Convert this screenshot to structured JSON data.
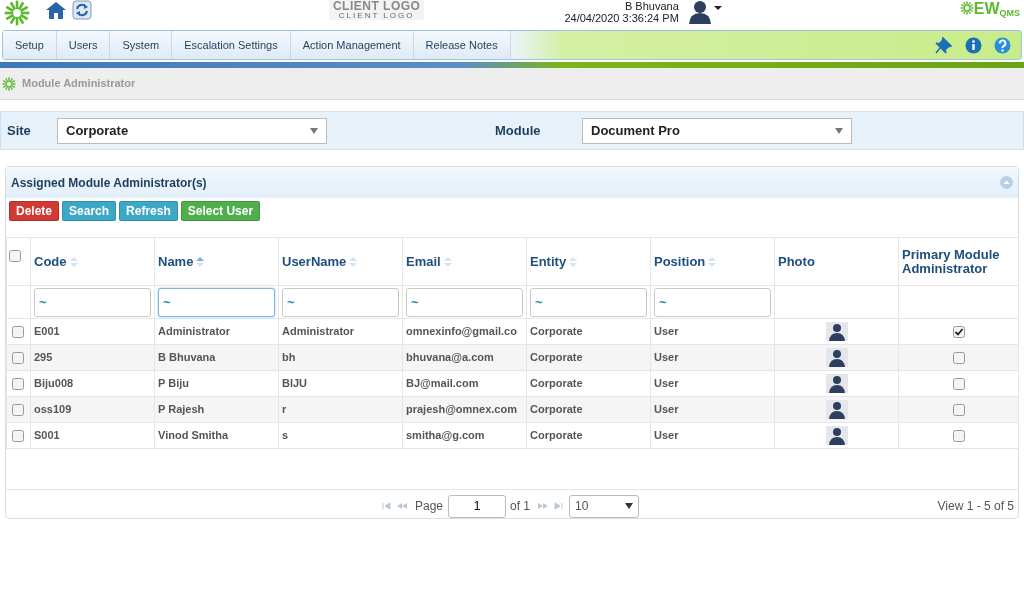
{
  "header": {
    "client_logo": "CLIENT LOGO",
    "client_logo_sub": "CLIENT LOGO",
    "user_name": "B Bhuvana",
    "datetime": "24/04/2020 3:36:24 PM",
    "brand": "EW",
    "brand_sub": "QMS"
  },
  "nav": {
    "items": [
      {
        "label": "Setup"
      },
      {
        "label": "Users"
      },
      {
        "label": "System"
      },
      {
        "label": "Escalation Settings"
      },
      {
        "label": "Action Management"
      },
      {
        "label": "Release Notes"
      }
    ]
  },
  "breadcrumb": {
    "items": [
      {
        "label": "Module Administrator"
      }
    ]
  },
  "selectors": [
    {
      "label": "Site",
      "value": "Corporate"
    },
    {
      "label": "Module",
      "value": "Document Pro"
    }
  ],
  "panel": {
    "title": "Assigned Module Administrator(s)",
    "buttons": [
      {
        "label": "Delete",
        "kind": "danger"
      },
      {
        "label": "Search",
        "kind": "info"
      },
      {
        "label": "Refresh",
        "kind": "info"
      },
      {
        "label": "Select User",
        "kind": "success"
      }
    ],
    "select_all": {
      "checked": false
    },
    "columns": [
      {
        "label": "Code",
        "sorted": false
      },
      {
        "label": "Name",
        "sorted": true
      },
      {
        "label": "UserName",
        "sorted": false
      },
      {
        "label": "Email",
        "sorted": false
      },
      {
        "label": "Entity",
        "sorted": false
      },
      {
        "label": "Position",
        "sorted": false
      },
      {
        "label": "Photo"
      },
      {
        "label": "Primary Module Administrator"
      }
    ],
    "filters": [
      {
        "value": "~",
        "focused": false
      },
      {
        "value": "~",
        "focused": true
      },
      {
        "value": "~",
        "focused": false
      },
      {
        "value": "~",
        "focused": false
      },
      {
        "value": "~",
        "focused": false
      },
      {
        "value": "~",
        "focused": false
      }
    ],
    "rows": [
      {
        "checked": false,
        "code": "E001",
        "name": "Administrator",
        "username": "Administrator",
        "email": "omnexinfo@gmail.co",
        "entity": "Corporate",
        "position": "User",
        "primary": true
      },
      {
        "checked": false,
        "code": "295",
        "name": "B Bhuvana",
        "username": "bh",
        "email": "bhuvana@a.com",
        "entity": "Corporate",
        "position": "User",
        "primary": false
      },
      {
        "checked": false,
        "code": "Biju008",
        "name": "P Biju",
        "username": "BIJU",
        "email": "BJ@mail.com",
        "entity": "Corporate",
        "position": "User",
        "primary": false
      },
      {
        "checked": false,
        "code": "oss109",
        "name": "P Rajesh",
        "username": "r",
        "email": "prajesh@omnex.com",
        "entity": "Corporate",
        "position": "User",
        "primary": false
      },
      {
        "checked": false,
        "code": "S001",
        "name": "Vinod Smitha",
        "username": "s",
        "email": "smitha@g.com",
        "entity": "Corporate",
        "position": "User",
        "primary": false
      }
    ],
    "pager": {
      "page_label": "Page",
      "page": "1",
      "of": "of 1",
      "page_size": "10",
      "view": "View 1 - 5 of 5"
    }
  }
}
